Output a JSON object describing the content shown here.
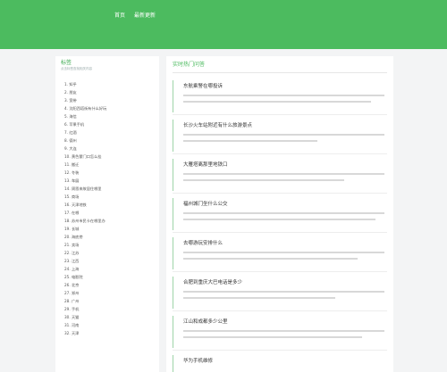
{
  "nav": {
    "items": [
      {
        "label": "首页"
      },
      {
        "label": "最新更新"
      }
    ]
  },
  "sidebar": {
    "title": "标签",
    "subtitle": "点击标签查找相关内容",
    "items": [
      {
        "label": "1. 知乎"
      },
      {
        "label": "2. 朋友"
      },
      {
        "label": "3. 宽带"
      },
      {
        "label": "4. 沈阳西塔街有什么好玩"
      },
      {
        "label": "5. 海信"
      },
      {
        "label": "6. 苹果手机"
      },
      {
        "label": "7. 红酒"
      },
      {
        "label": "8. 德州"
      },
      {
        "label": "9. 大连"
      },
      {
        "label": "10. 黄色蒙门口怎么挂"
      },
      {
        "label": "11. 搬迁"
      },
      {
        "label": "12. 冬装"
      },
      {
        "label": "13. 车展"
      },
      {
        "label": "14. 周恩来故居住哪里"
      },
      {
        "label": "15. 商场"
      },
      {
        "label": "16. 天津地铁"
      },
      {
        "label": "17. 在哪"
      },
      {
        "label": "18. 苏州市民卡在哪里办"
      },
      {
        "label": "19. 长城"
      },
      {
        "label": "20. 海底捞"
      },
      {
        "label": "21. 卖场"
      },
      {
        "label": "22. 江苏"
      },
      {
        "label": "23. 江西"
      },
      {
        "label": "24. 上海"
      },
      {
        "label": "25. 电影院"
      },
      {
        "label": "26. 北京"
      },
      {
        "label": "27. 郑州"
      },
      {
        "label": "28. 广州"
      },
      {
        "label": "29. 手机"
      },
      {
        "label": "30. 天猫"
      },
      {
        "label": "31. 河南"
      },
      {
        "label": "32. 天津"
      }
    ]
  },
  "main": {
    "heading": "实时热门问答",
    "cards": [
      {
        "title": "东航乘警在哪投诉"
      },
      {
        "title": "长沙火车站附近有什么旅游景点"
      },
      {
        "title": "大雁塔离那里地铁口"
      },
      {
        "title": "福州城门坐什么公交"
      },
      {
        "title": "去哪游玩安排什么"
      },
      {
        "title": "合肥到重庆大巴电话是多少"
      },
      {
        "title": "江山和成都多少公里"
      },
      {
        "title": "华为手机维修"
      }
    ]
  }
}
